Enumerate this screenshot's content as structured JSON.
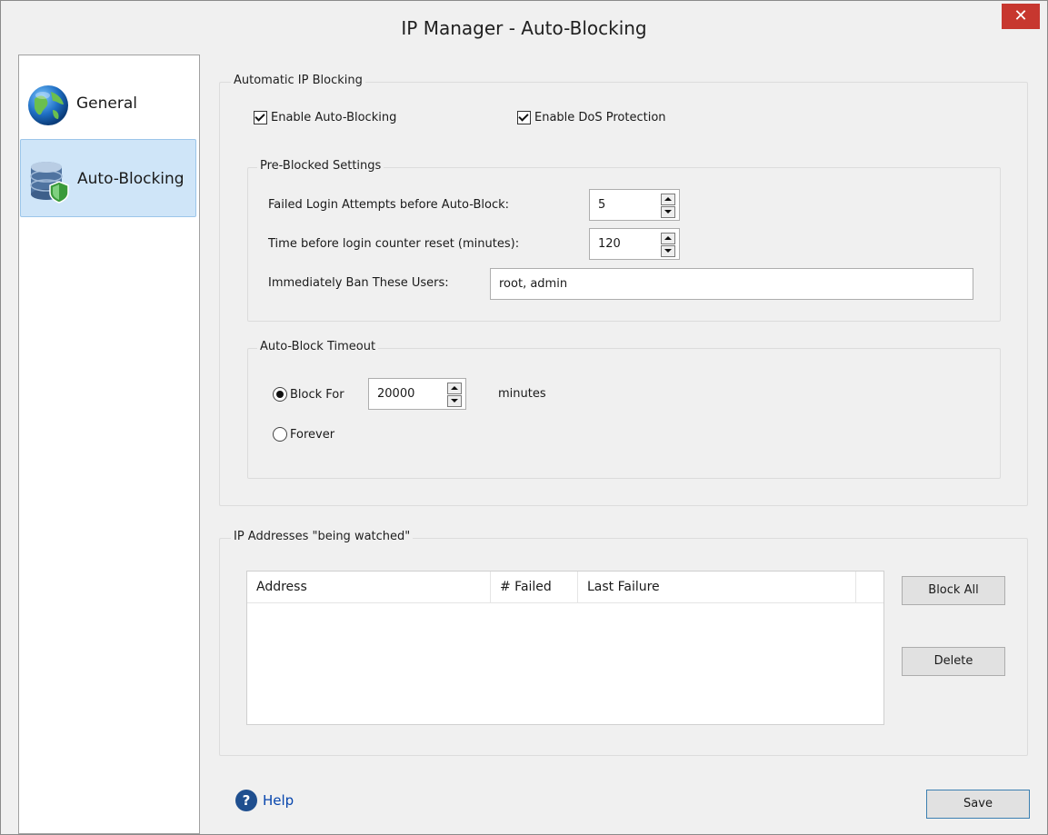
{
  "window": {
    "title": "IP Manager - Auto-Blocking",
    "close_glyph": "✕"
  },
  "sidebar": {
    "items": [
      {
        "label": "General",
        "icon": "globe-icon"
      },
      {
        "label": "Auto-Blocking",
        "icon": "database-shield-icon",
        "active": true
      }
    ]
  },
  "automatic": {
    "legend": "Automatic IP Blocking",
    "enable_auto_blocking": {
      "label": "Enable Auto-Blocking",
      "checked": true
    },
    "enable_dos": {
      "label": "Enable DoS Protection",
      "checked": true
    }
  },
  "preblocked": {
    "legend": "Pre-Blocked Settings",
    "failed_attempts_label": "Failed Login Attempts before Auto-Block:",
    "failed_attempts_value": "5",
    "reset_label": "Time before login counter reset (minutes):",
    "reset_value": "120",
    "ban_users_label": "Immediately Ban These Users:",
    "ban_users_value": "root, admin"
  },
  "timeout": {
    "legend": "Auto-Block Timeout",
    "block_for_label": "Block For",
    "block_for_value": "20000",
    "minutes_label": "minutes",
    "forever_label": "Forever",
    "selected": "block_for"
  },
  "watched": {
    "legend": "IP Addresses \"being watched\"",
    "columns": [
      "Address",
      "# Failed",
      "Last Failure"
    ],
    "rows": [],
    "block_all_label": "Block All",
    "delete_label": "Delete"
  },
  "footer": {
    "help_label": "Help",
    "save_label": "Save"
  },
  "colors": {
    "close_bg": "#c7372f",
    "active_nav_bg": "#cfe5f8",
    "link": "#0645ad"
  }
}
